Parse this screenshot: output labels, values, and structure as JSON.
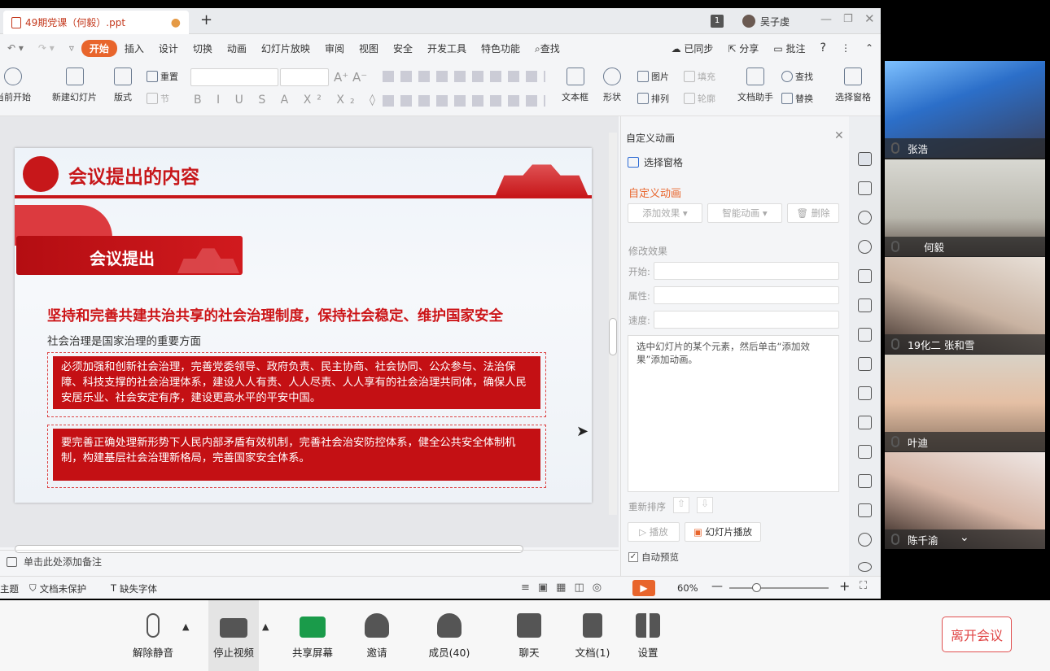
{
  "titlebar": {
    "doc_tab": "49期党课（何毅）.ppt",
    "add_tab": "+",
    "badge": "1",
    "user": "吴子虔"
  },
  "menu": {
    "items": [
      "开始",
      "插入",
      "设计",
      "切换",
      "动画",
      "幻灯片放映",
      "审阅",
      "视图",
      "安全",
      "开发工具",
      "特色功能"
    ],
    "search": "查找",
    "sync": "已同步",
    "share": "分享",
    "annotate": "批注",
    "help": "?"
  },
  "ribbon": {
    "from_current": "当前开始",
    "new_slide": "新建幻灯片",
    "layout": "版式",
    "reset": "重置",
    "section": "节",
    "textbox": "文本框",
    "shape": "形状",
    "picture": "图片",
    "fill": "填充",
    "arrange": "排列",
    "outline": "轮廓",
    "doc_helper": "文档助手",
    "find": "查找",
    "replace": "替换",
    "select_pane": "选择窗格"
  },
  "slide": {
    "title": "会议提出的内容",
    "banner": "会议提出",
    "heading": "坚持和完善共建共治共享的社会治理制度，保持社会稳定、维护国家安全",
    "subheading": "社会治理是国家治理的重要方面",
    "box1": "必须加强和创新社会治理，完善党委领导、政府负责、民主协商、社会协同、公众参与、法治保障、科技支撑的社会治理体系，建设人人有责、人人尽责、人人享有的社会治理共同体，确保人民安居乐业、社会安定有序，建设更高水平的平安中国。",
    "box2": "要完善正确处理新形势下人民内部矛盾有效机制，完善社会治安防控体系，健全公共安全体制机制，构建基层社会治理新格局，完善国家安全体系。"
  },
  "notes": {
    "placeholder": "单击此处添加备注"
  },
  "status": {
    "theme": "主题",
    "protect": "文档未保护",
    "missing_font": "缺失字体",
    "zoom": "60%"
  },
  "pane": {
    "title": "自定义动画",
    "select_pane": "选择窗格",
    "section": "自定义动画",
    "add_effect": "添加效果",
    "smart_anim": "智能动画",
    "delete": "删除",
    "modify": "修改效果",
    "start": "开始:",
    "property": "属性:",
    "speed": "速度:",
    "hint": "选中幻灯片的某个元素，然后单击“添加效果”添加动画。",
    "reorder": "重新排序",
    "play": "播放",
    "slideshow": "幻灯片播放",
    "autopreview": "自动预览"
  },
  "participants": [
    "张浩",
    "何毅",
    "19化二 张和雪",
    "叶迪",
    "陈千渝"
  ],
  "meeting": {
    "unmute": "解除静音",
    "stop_video": "停止视频",
    "share_screen": "共享屏幕",
    "invite": "邀请",
    "members": "成员(40)",
    "chat": "聊天",
    "docs": "文档(1)",
    "settings": "设置",
    "leave": "离开会议"
  }
}
